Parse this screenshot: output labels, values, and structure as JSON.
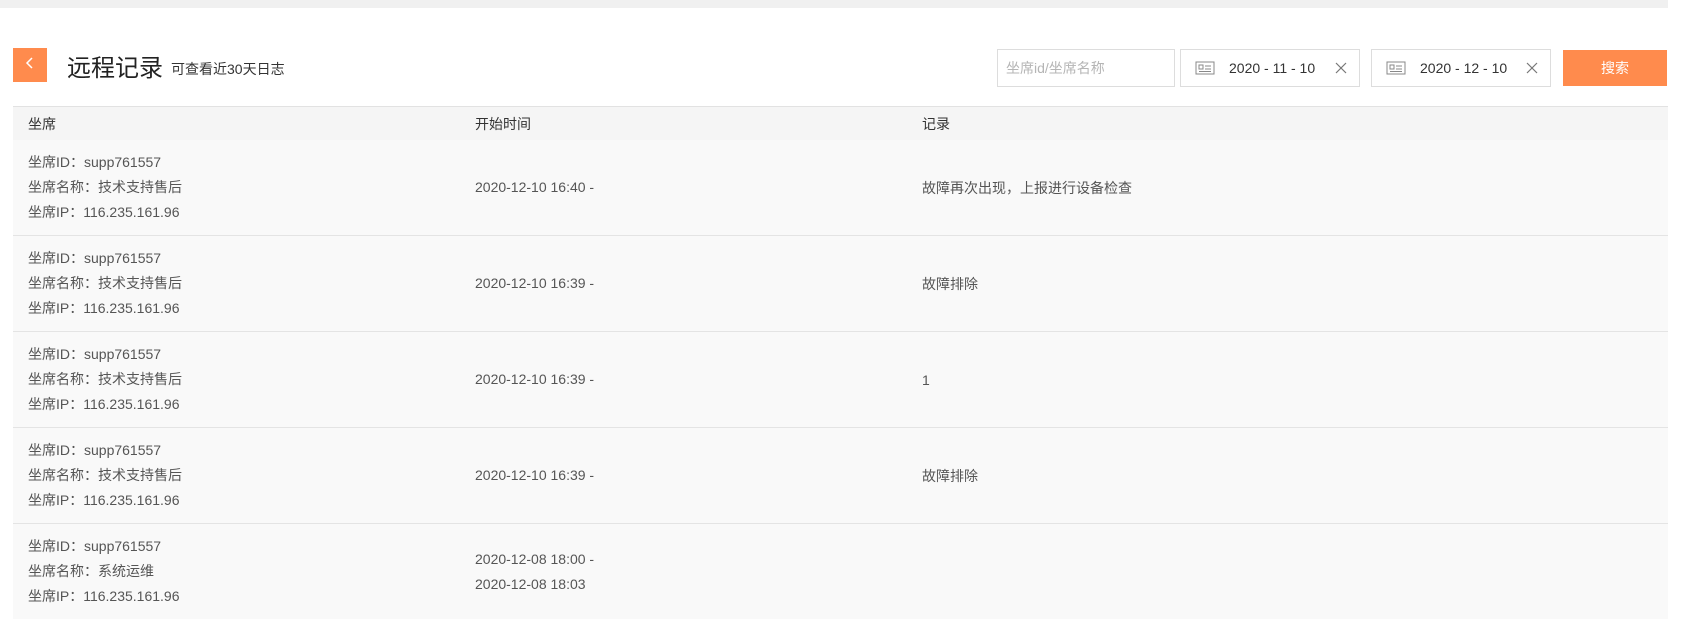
{
  "header": {
    "title": "远程记录",
    "subtitle": "可查看近30天日志"
  },
  "filters": {
    "search_placeholder": "坐席id/坐席名称",
    "start_date": "2020 - 11 - 10",
    "end_date": "2020 - 12 - 10",
    "search_label": "搜索"
  },
  "table": {
    "columns": [
      "坐席",
      "开始时间",
      "记录"
    ],
    "rows": [
      {
        "id": "坐席ID：supp761557",
        "name": "坐席名称：技术支持售后",
        "ip": "坐席IP：116.235.161.96",
        "time1": "2020-12-10 16:40 -",
        "time2": "",
        "record": "故障再次出现，上报进行设备检查"
      },
      {
        "id": "坐席ID：supp761557",
        "name": "坐席名称：技术支持售后",
        "ip": "坐席IP：116.235.161.96",
        "time1": "2020-12-10 16:39 -",
        "time2": "",
        "record": "故障排除"
      },
      {
        "id": "坐席ID：supp761557",
        "name": "坐席名称：技术支持售后",
        "ip": "坐席IP：116.235.161.96",
        "time1": "2020-12-10 16:39 -",
        "time2": "",
        "record": "1"
      },
      {
        "id": "坐席ID：supp761557",
        "name": "坐席名称：技术支持售后",
        "ip": "坐席IP：116.235.161.96",
        "time1": "2020-12-10 16:39 -",
        "time2": "",
        "record": "故障排除"
      },
      {
        "id": "坐席ID：supp761557",
        "name": "坐席名称：系统运维",
        "ip": "坐席IP：116.235.161.96",
        "time1": "2020-12-08 18:00 -",
        "time2": "2020-12-08 18:03",
        "record": ""
      }
    ]
  },
  "colors": {
    "accent": "#ff8b4d"
  },
  "icons": {
    "back": "chevron-left-icon",
    "calendar": "calendar-icon",
    "clear": "close-icon"
  }
}
